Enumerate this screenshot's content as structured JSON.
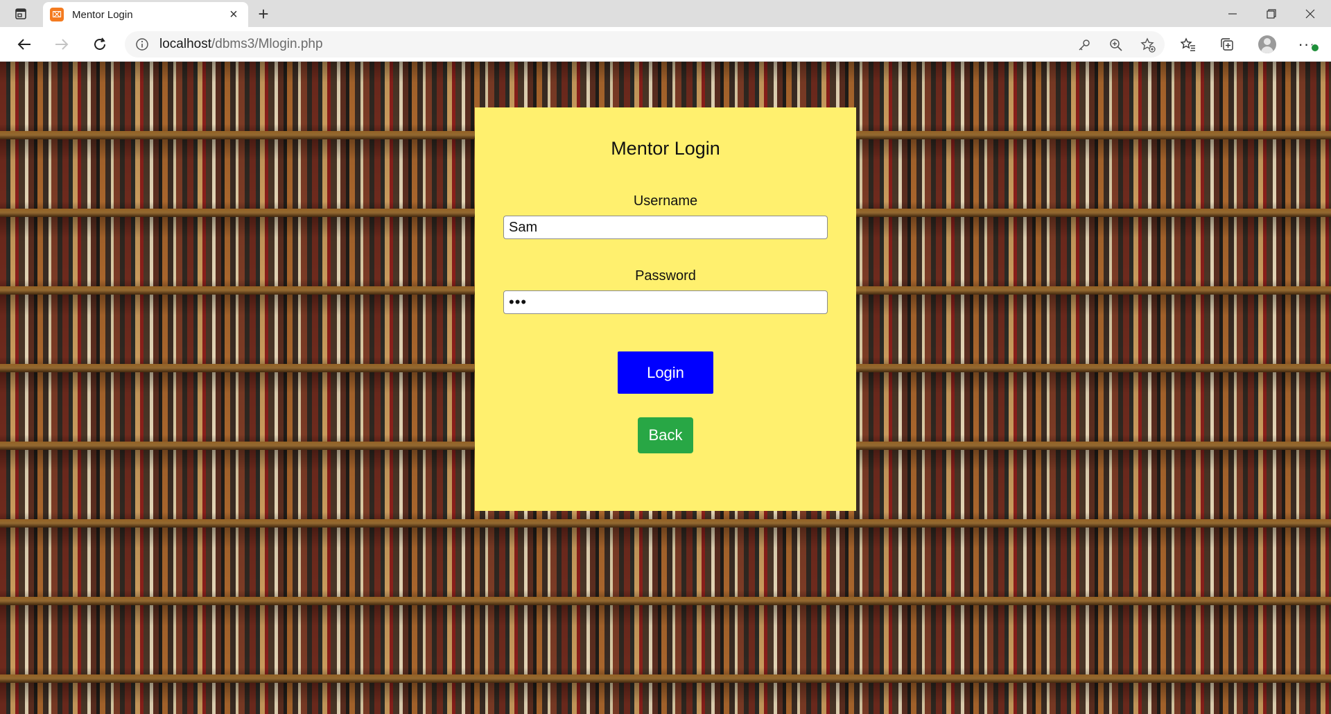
{
  "browser": {
    "tab_title": "Mentor Login",
    "favicon_text": "⌧",
    "url_host": "localhost",
    "url_path": "/dbms3/Mlogin.php"
  },
  "page": {
    "title": "Mentor Login",
    "username_label": "Username",
    "username_value": "Sam",
    "password_label": "Password",
    "password_masked": "•••",
    "login_label": "Login",
    "back_label": "Back"
  },
  "colors": {
    "card": "#fff06e",
    "login_button": "#0000ff",
    "back_button": "#28a745"
  }
}
